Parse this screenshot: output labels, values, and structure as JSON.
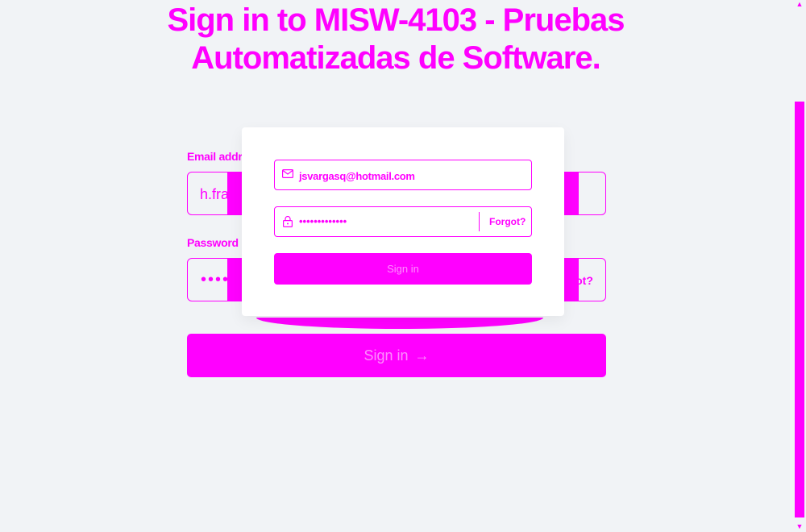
{
  "title": "Sign in to MISW-4103 - Pruebas Automatizadas de Software.",
  "form": {
    "email_label": "Email address",
    "email_value": "h.franco@uniandes.edu.co",
    "password_label": "Password",
    "password_mask": "••••••••••",
    "forgot_label": "Forgot?",
    "signin_label": "Sign in",
    "signin_arrow": "→"
  },
  "overlay": {
    "email_value": "jsvargasq@hotmail.com",
    "password_mask": "•••••••••••••",
    "forgot_label": "Forgot?",
    "signin_label": "Sign in"
  },
  "icons": {
    "mail": "mail-icon",
    "lock": "lock-icon",
    "arrow": "arrow-right-icon"
  },
  "colors": {
    "accent": "#ff00ff",
    "background": "#f1f3f6",
    "card": "#ffffff"
  }
}
